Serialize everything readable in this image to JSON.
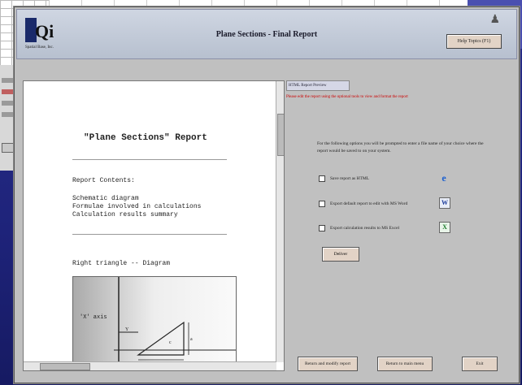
{
  "header": {
    "title": "Plane Sections - Final Report",
    "logo_text": "Qi",
    "logo_subtitle": "Spatial Base, Inc.",
    "help_label": "Help Topics (F1)"
  },
  "report": {
    "title": "\"Plane Sections\" Report",
    "contents_heading": "Report Contents:",
    "contents_items": [
      "Schematic diagram",
      "Formulae involved in calculations",
      "Calculation results summary"
    ],
    "diagram_heading": "Right triangle -- Diagram",
    "diagram_axis_label": "'X' axis"
  },
  "right": {
    "tag": "HTML Report Preview",
    "note": "Please edit the report using the optional tools to view and format the report",
    "instructions": "For the following options you will be prompted to enter a file name of your choice where the report would be saved to on your system.",
    "options": [
      {
        "label": "Save report as HTML",
        "icon": "ie-icon"
      },
      {
        "label": "Export default report to edit with MS Word",
        "icon": "word-icon"
      },
      {
        "label": "Export calculation results to MS Excel",
        "icon": "excel-icon"
      }
    ],
    "deliver_label": "Deliver"
  },
  "footer": {
    "return_modify": "Return and modify report",
    "return_main": "Return to main menu",
    "exit": "Exit"
  }
}
